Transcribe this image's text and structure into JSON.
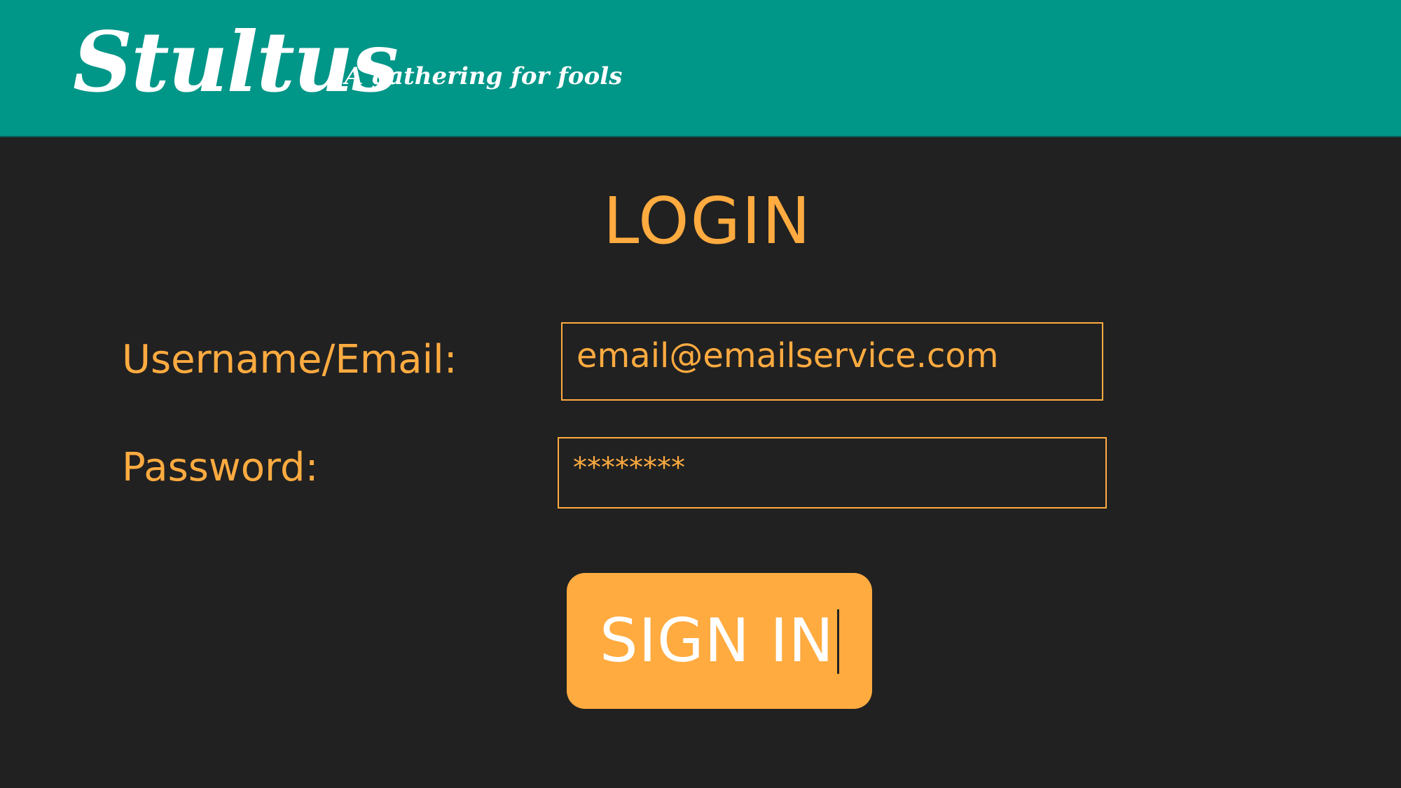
{
  "header": {
    "logo": "Stultus",
    "tagline": "A gathering for fools"
  },
  "login": {
    "title": "LOGIN",
    "username_label": "Username/Email:",
    "username_value": "email@emailservice.com",
    "password_label": "Password:",
    "password_value": "********",
    "signin_label": "SIGN IN"
  },
  "colors": {
    "header_bg": "#009688",
    "page_bg": "#212121",
    "accent": "#ffab40",
    "button_text": "#ffffff"
  }
}
